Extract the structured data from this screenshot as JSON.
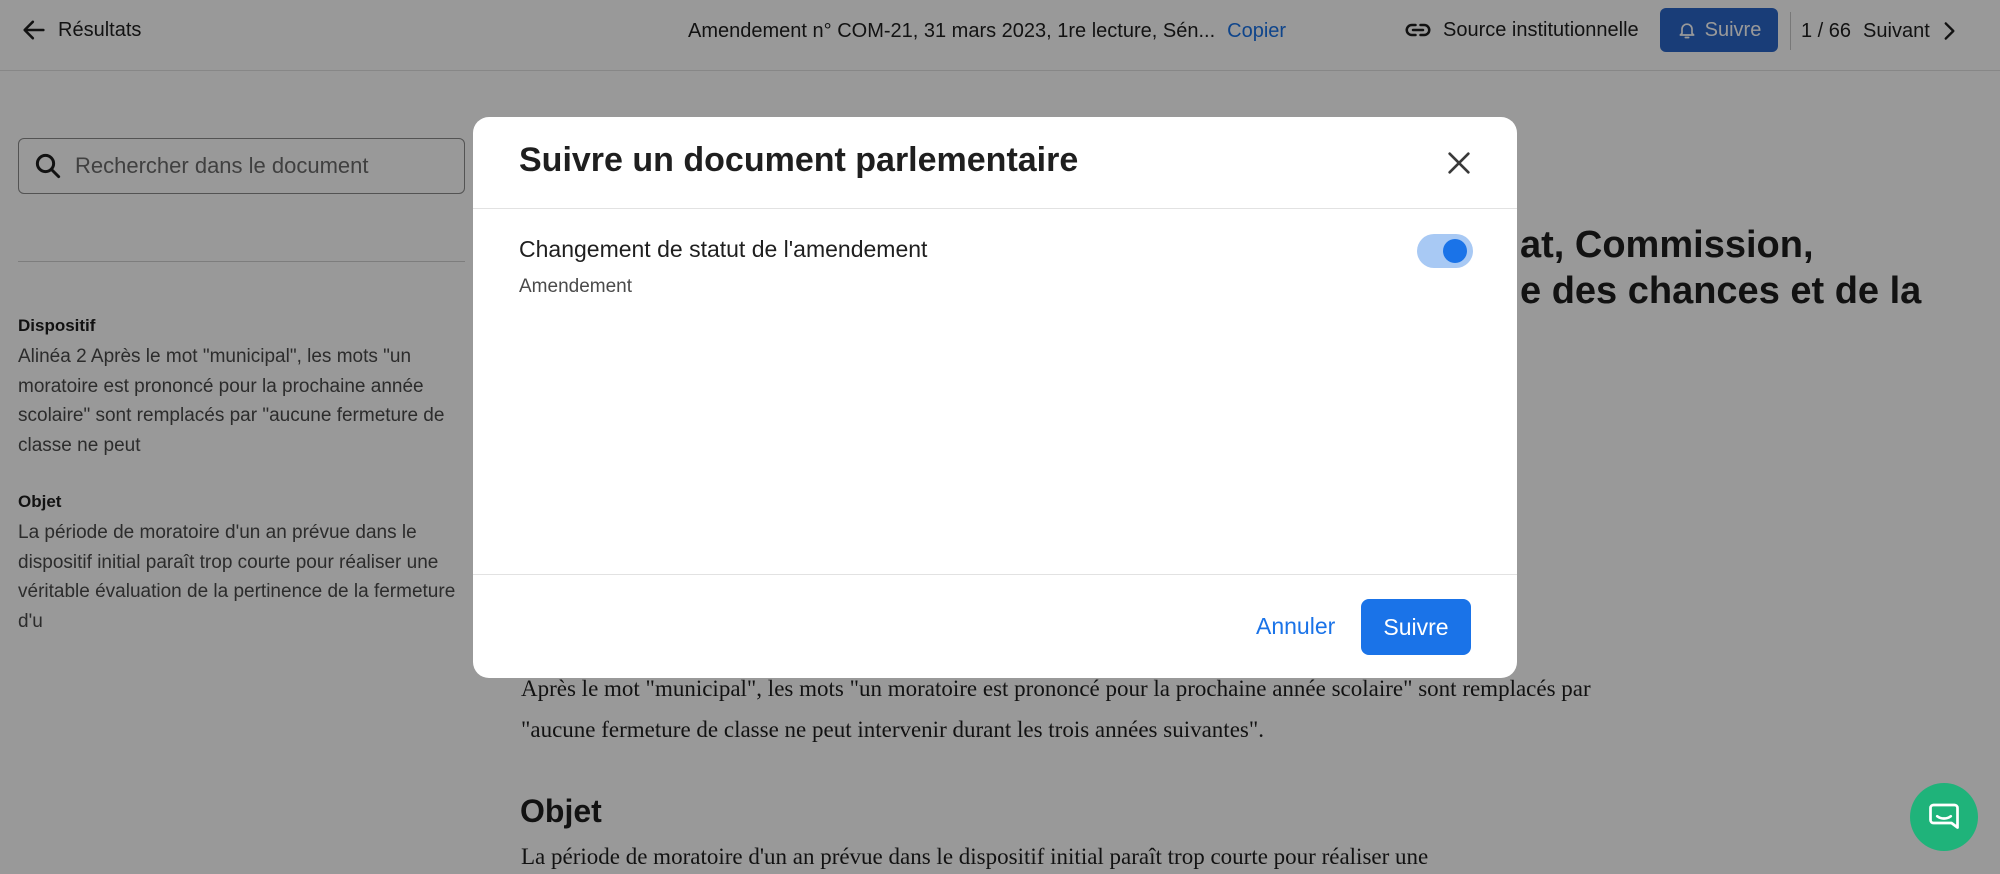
{
  "topbar": {
    "back_label": "Résultats",
    "doc_title": "Amendement n° COM-21, 31 mars 2023, 1re lecture, Sén...",
    "copy_label": "Copier",
    "source_label": "Source institutionnelle",
    "follow_label": "Suivre",
    "pager_position": "1 / 66",
    "next_label": "Suivant"
  },
  "search": {
    "placeholder": "Rechercher dans le document"
  },
  "left_panel": {
    "dispositif_title": "Dispositif",
    "dispositif_text": "Alinéa 2 Après le mot \"municipal\", les mots \"un moratoire est prononcé pour la prochaine année scolaire\" sont remplacés par \"aucune fermeture de classe ne peut",
    "objet_title": "Objet",
    "objet_text": "La période de moratoire d'un an prévue dans le dispositif initial paraît trop courte pour réaliser une véritable évaluation de la pertinence de la fermeture d'u"
  },
  "main": {
    "heading_line1": "at, Commission,",
    "heading_line2": "e des chances et de la",
    "dispositif_para": "Après le mot \"municipal\", les mots \"un moratoire est prononcé pour la prochaine année scolaire\" sont remplacés par \"aucune fermeture de classe ne peut intervenir durant les trois années suivantes\".",
    "objet_heading": "Objet",
    "objet_para": "La période de moratoire d'un an prévue dans le dispositif initial paraît trop courte pour réaliser une"
  },
  "modal": {
    "title": "Suivre un document parlementaire",
    "option_label": "Changement de statut de l'amendement",
    "option_sub": "Amendement",
    "toggle_on": true,
    "cancel_label": "Annuler",
    "confirm_label": "Suivre"
  },
  "colors": {
    "accent": "#1a73e8",
    "follow_top": "#2a66c9",
    "chat": "#1fb37a"
  },
  "icons": {
    "back": "arrow-left-icon",
    "source": "link-icon",
    "bell": "bell-icon",
    "next": "chevron-right-icon",
    "search": "search-icon",
    "close": "close-icon",
    "chat": "chat-icon"
  }
}
